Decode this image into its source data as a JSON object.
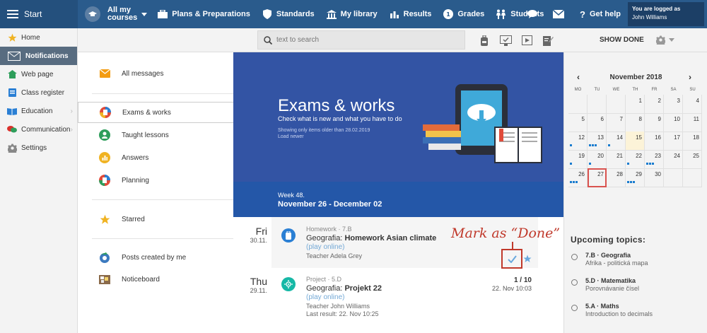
{
  "topbar": {
    "start": "Start",
    "my_courses": [
      "All my",
      "courses"
    ],
    "nav": [
      "Plans & Preparations",
      "Standards",
      "My library",
      "Results",
      "Grades",
      "Students"
    ],
    "get_help": "Get help",
    "logged_as": "You are logged as",
    "user_name": "John Williams"
  },
  "sidebar": {
    "items": [
      {
        "label": "Home",
        "icon": "star-icon"
      },
      {
        "label": "Notifications",
        "icon": "envelope-icon",
        "active": true
      },
      {
        "label": "Web page",
        "icon": "house-icon"
      },
      {
        "label": "Class register",
        "icon": "register-icon"
      },
      {
        "label": "Education",
        "icon": "book-icon"
      },
      {
        "label": "Communication",
        "icon": "chat-icon"
      },
      {
        "label": "Settings",
        "icon": "gear-icon"
      }
    ]
  },
  "subheader": {
    "search_placeholder": "text to search",
    "show_done": "SHOW DONE"
  },
  "filters": {
    "all": "All messages",
    "exams": "Exams & works",
    "taught": "Taught lessons",
    "answers": "Answers",
    "planning": "Planning",
    "starred": "Starred",
    "created": "Posts created by me",
    "noticeboard": "Noticeboard"
  },
  "hero": {
    "title": "Exams & works",
    "subtitle": "Check what is new and what you have to do",
    "note1": "Showing only items older than 28.02.2019",
    "note2": "Load newer"
  },
  "week": {
    "label": "Week 48.",
    "range": "November 26 - December 02"
  },
  "entries": [
    {
      "day": "Fri",
      "date": "30.11.",
      "type": "Homework · 7.B",
      "subject": "Geografia:",
      "title": "Homework Asian climate",
      "link": "(play online)",
      "teacher": "Teacher Adela Grey"
    },
    {
      "day": "Thu",
      "date": "29.11.",
      "type": "Project · 5.D",
      "subject": "Geografia:",
      "title": "Projekt 22",
      "link": "(play online)",
      "teacher": "Teacher John Williams",
      "result": "Last result: 22. Nov 10:25",
      "score": "1 / 10",
      "deadline": "22. Nov 10:03"
    }
  ],
  "annotation": "Mark as “Done”",
  "calendar": {
    "month": "November 2018",
    "dow": [
      "MO",
      "TU",
      "WE",
      "TH",
      "FR",
      "SA",
      "SU"
    ],
    "days": [
      "1",
      "2",
      "3",
      "4",
      "5",
      "6",
      "7",
      "8",
      "9",
      "10",
      "11",
      "12",
      "13",
      "14",
      "15",
      "16",
      "17",
      "18",
      "19",
      "20",
      "21",
      "22",
      "23",
      "24",
      "25",
      "26",
      "27",
      "28",
      "29",
      "30"
    ]
  },
  "upcoming": {
    "title": "Upcoming topics:",
    "items": [
      {
        "class": "7.B · Geografia",
        "topic": "Afrika - politická mapa"
      },
      {
        "class": "5.D · Matematika",
        "topic": "Porovnávanie čísel"
      },
      {
        "class": "5.A · Maths",
        "topic": "Introduction to decimals"
      }
    ]
  },
  "colors": {
    "topbar": "#2a5b8c",
    "hero": "#3354a4",
    "week": "#2457a8",
    "annotation": "#c0392b",
    "dots": "#1a7ccf"
  }
}
